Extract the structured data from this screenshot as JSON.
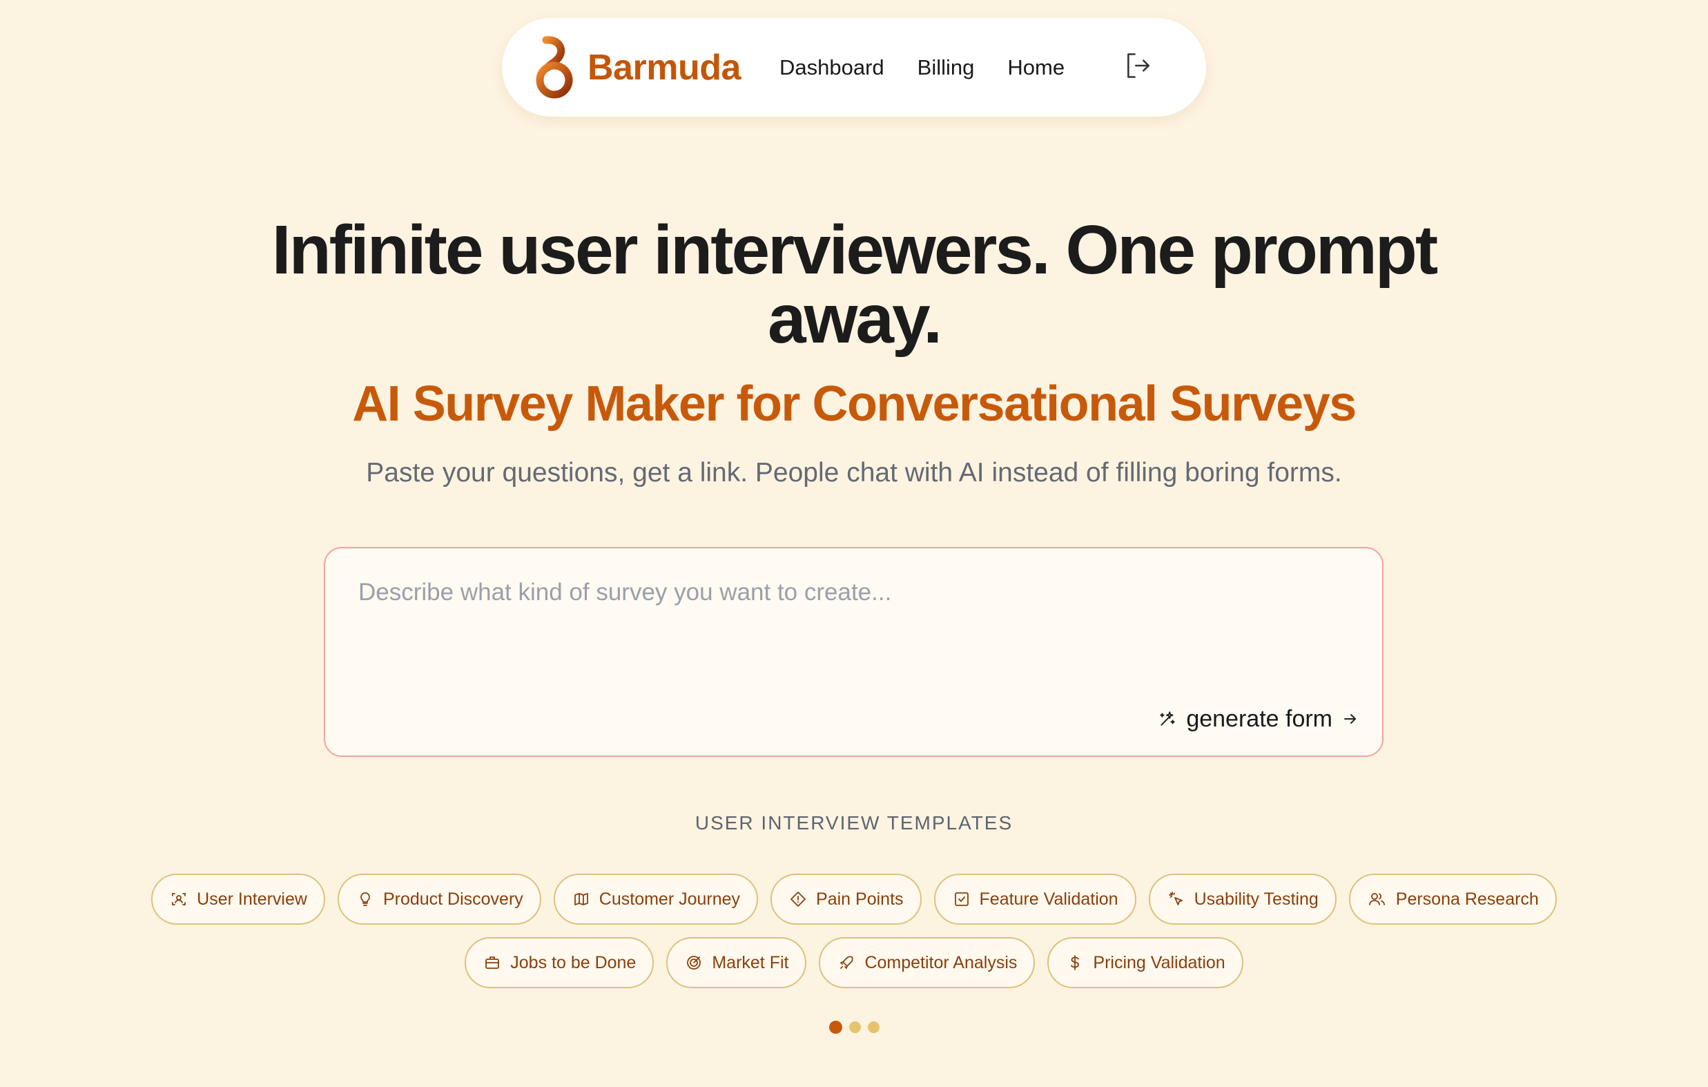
{
  "nav": {
    "brand": "Barmuda",
    "links": [
      {
        "label": "Dashboard"
      },
      {
        "label": "Billing"
      },
      {
        "label": "Home"
      }
    ],
    "logout_icon": "logout-icon"
  },
  "hero": {
    "title": "Infinite user interviewers. One prompt away.",
    "subtitle": "AI Survey Maker for Conversational Surveys",
    "description": "Paste your questions, get a link. People chat with AI instead of filling boring forms."
  },
  "prompt": {
    "placeholder": "Describe what kind of survey you want to create...",
    "value": "",
    "generate_label": "generate form"
  },
  "templates": {
    "heading": "USER INTERVIEW TEMPLATES",
    "row1": [
      {
        "label": "User Interview",
        "icon": "scan-user-icon"
      },
      {
        "label": "Product Discovery",
        "icon": "lightbulb-icon"
      },
      {
        "label": "Customer Journey",
        "icon": "map-icon"
      },
      {
        "label": "Pain Points",
        "icon": "diamond-icon"
      },
      {
        "label": "Feature Validation",
        "icon": "check-square-icon"
      },
      {
        "label": "Usability Testing",
        "icon": "cursor-click-icon"
      },
      {
        "label": "Persona Research",
        "icon": "users-icon"
      }
    ],
    "row2": [
      {
        "label": "Jobs to be Done",
        "icon": "briefcase-icon"
      },
      {
        "label": "Market Fit",
        "icon": "target-icon"
      },
      {
        "label": "Competitor Analysis",
        "icon": "rocket-icon"
      },
      {
        "label": "Pricing Validation",
        "icon": "dollar-icon"
      }
    ]
  },
  "pagination": {
    "pages": 3,
    "active": 1
  },
  "colors": {
    "background": "#fdf3e1",
    "brand": "#c45608",
    "accent": "#c75a0a",
    "chip_border": "#dcc27c",
    "prompt_border": "#f3a3a0"
  }
}
